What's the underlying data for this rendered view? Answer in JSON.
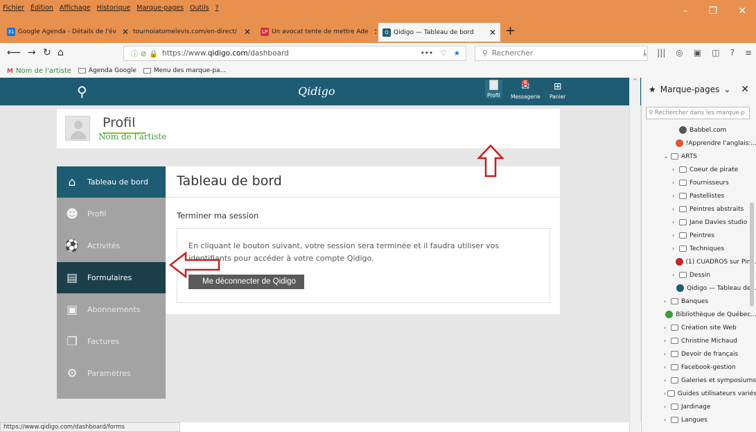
{
  "menu": [
    "Fichier",
    "Édition",
    "Affichage",
    "Historique",
    "Marque-pages",
    "Outils",
    "?"
  ],
  "tabs": [
    {
      "label": "Google Agenda - Détails de l'év",
      "icon": "calendar-icon",
      "color": "#1a73e8",
      "glyph": "31"
    },
    {
      "label": "tournoiatomelevis.com/en-direct/",
      "icon": "",
      "color": "",
      "glyph": ""
    },
    {
      "label": "Un avocat tente de mettre Ade",
      "icon": "lp-icon",
      "color": "#d4303a",
      "glyph": "LP"
    },
    {
      "label": "Qidigo — Tableau de bord",
      "icon": "qidigo-icon",
      "color": "#1d5c73",
      "glyph": "Q"
    }
  ],
  "url": {
    "prefix": "https://www.",
    "host": "qidigo.com",
    "path": "/dashboard"
  },
  "search_placeholder": "Rechercher",
  "bookmarks_bar": {
    "profile": "Nom de l'artiste",
    "items": [
      "Agenda Google",
      "Menu des marque-pa..."
    ]
  },
  "site": {
    "logo": "Qidigo",
    "header_icons": [
      {
        "label": "Profil",
        "glyph": ""
      },
      {
        "label": "Messagerie",
        "glyph": "✉",
        "badge": "6"
      },
      {
        "label": "Panier",
        "glyph": "⊞"
      }
    ],
    "profile_title": "Profil",
    "artist_name": "Nom de l'artiste",
    "nav": [
      {
        "label": "Tableau de bord",
        "glyph": "⌂"
      },
      {
        "label": "Profil",
        "glyph": "☻"
      },
      {
        "label": "Activités",
        "glyph": "⚽"
      },
      {
        "label": "Formulaires",
        "glyph": "▤"
      },
      {
        "label": "Abonnements",
        "glyph": "▣"
      },
      {
        "label": "Factures",
        "glyph": "❐"
      },
      {
        "label": "Paramètres",
        "glyph": "⚙"
      }
    ],
    "main_title": "Tableau de bord",
    "section_title": "Terminer ma session",
    "message": "En cliquant le bouton suivant, votre session sera terminée et il faudra utiliser vos identifiants pour accéder à votre compte Qidigo.",
    "logout_button": "Me déconnecter de Qidigo"
  },
  "status_url": "https://www.qidigo.com/dashboard/forms",
  "sidebar": {
    "title": "Marque-pages",
    "search_placeholder": "Rechercher dans les marque-p",
    "items": [
      {
        "label": "Babbel.com",
        "indent": 2,
        "type": "link",
        "color": "#555"
      },
      {
        "label": "!Apprendre l'anglais:...",
        "indent": 2,
        "type": "link",
        "color": "#e2543a"
      },
      {
        "label": "ARTS",
        "indent": 1,
        "type": "folder-open"
      },
      {
        "label": "Coeur de pirate",
        "indent": 2,
        "type": "folder"
      },
      {
        "label": "Fournisseurs",
        "indent": 2,
        "type": "folder"
      },
      {
        "label": "Pastellistes",
        "indent": 2,
        "type": "folder"
      },
      {
        "label": "Peintres abstraits",
        "indent": 2,
        "type": "folder"
      },
      {
        "label": "Jane Davies studio",
        "indent": 2,
        "type": "folder"
      },
      {
        "label": "Peintres",
        "indent": 2,
        "type": "folder"
      },
      {
        "label": "Techniques",
        "indent": 2,
        "type": "folder"
      },
      {
        "label": "(1) CUADROS sur Pin...",
        "indent": 2,
        "type": "link",
        "color": "#c8232c"
      },
      {
        "label": "Dessin",
        "indent": 2,
        "type": "folder"
      },
      {
        "label": "Qidigo — Tableau de...",
        "indent": 2,
        "type": "link",
        "color": "#1d5c73"
      },
      {
        "label": "Banques",
        "indent": 1,
        "type": "folder"
      },
      {
        "label": "Bibliothèque de Québec...",
        "indent": 1,
        "type": "link",
        "color": "#3a9d3a"
      },
      {
        "label": "Création site Web",
        "indent": 1,
        "type": "folder"
      },
      {
        "label": "Christine Michaud",
        "indent": 1,
        "type": "folder"
      },
      {
        "label": "Devoir de français",
        "indent": 1,
        "type": "folder"
      },
      {
        "label": "Facebook-gestion",
        "indent": 1,
        "type": "folder"
      },
      {
        "label": "Galeries et symposiums",
        "indent": 1,
        "type": "folder"
      },
      {
        "label": "Guides utilisateurs variés",
        "indent": 1,
        "type": "folder"
      },
      {
        "label": "Jardinage",
        "indent": 1,
        "type": "folder"
      },
      {
        "label": "Langues",
        "indent": 1,
        "type": "folder"
      }
    ]
  }
}
